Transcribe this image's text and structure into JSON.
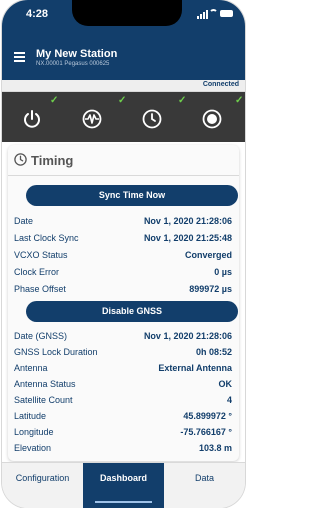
{
  "status_bar": {
    "time": "4:28"
  },
  "header": {
    "title": "My New Station",
    "subtitle": "NX.00001 Pegasus 000625"
  },
  "connection": {
    "status": "Connected"
  },
  "status_icons": [
    {
      "icon": "power-icon",
      "check": "✓"
    },
    {
      "icon": "waveform-icon",
      "check": "✓"
    },
    {
      "icon": "clock-icon",
      "check": "✓"
    },
    {
      "icon": "record-icon",
      "check": "✓"
    }
  ],
  "timing": {
    "title": "Timing",
    "sync_button": "Sync Time Now",
    "rows": [
      {
        "label": "Date",
        "value": "Nov 1, 2020 21:28:06"
      },
      {
        "label": "Last Clock Sync",
        "value": "Nov 1, 2020 21:25:48"
      },
      {
        "label": "VCXO Status",
        "value": "Converged"
      },
      {
        "label": "Clock Error",
        "value": "0 µs"
      },
      {
        "label": "Phase Offset",
        "value": "899972 µs"
      }
    ],
    "gnss_button": "Disable GNSS",
    "gnss_rows": [
      {
        "label": "Date (GNSS)",
        "value": "Nov 1, 2020 21:28:06"
      },
      {
        "label": "GNSS Lock Duration",
        "value": "0h 08:52"
      },
      {
        "label": "Antenna",
        "value": "External Antenna"
      },
      {
        "label": "Antenna Status",
        "value": "OK"
      },
      {
        "label": "Satellite Count",
        "value": "4"
      },
      {
        "label": "Latitude",
        "value": "45.899972 °"
      },
      {
        "label": "Longitude",
        "value": "-75.766167 °"
      },
      {
        "label": "Elevation",
        "value": "103.8 m"
      }
    ]
  },
  "tabs": [
    {
      "label": "Configuration",
      "active": false
    },
    {
      "label": "Dashboard",
      "active": true
    },
    {
      "label": "Data",
      "active": false
    }
  ],
  "colors": {
    "primary": "#123e6b",
    "check_green": "#6ed04c",
    "icon_strip": "#393939"
  }
}
